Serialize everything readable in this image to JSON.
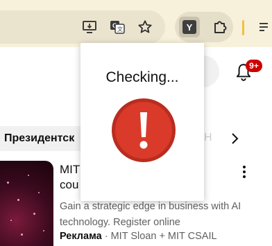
{
  "browser": {
    "toolbar": {
      "icons": [
        "install-app-icon",
        "translate-icon",
        "bookmark-star-icon",
        "extension-y-icon",
        "puzzle-extensions-icon"
      ],
      "extension_y_letter": "Y"
    }
  },
  "page": {
    "notifications": {
      "badge": "9+"
    },
    "chips": {
      "active": "Президентск",
      "ghost": "Н"
    },
    "ad": {
      "title_line1": "MIT",
      "title_line2": "cou",
      "description": "Gain a strategic edge in business with AI technology. Register online",
      "label": "Реклама",
      "separator": "·",
      "advertiser": "MIT Sloan + MIT CSAIL"
    }
  },
  "popup": {
    "status": "Checking...",
    "icon": "alert-exclamation-icon",
    "icon_color": "#d93a2a",
    "icon_ring_color": "#b92d20"
  }
}
